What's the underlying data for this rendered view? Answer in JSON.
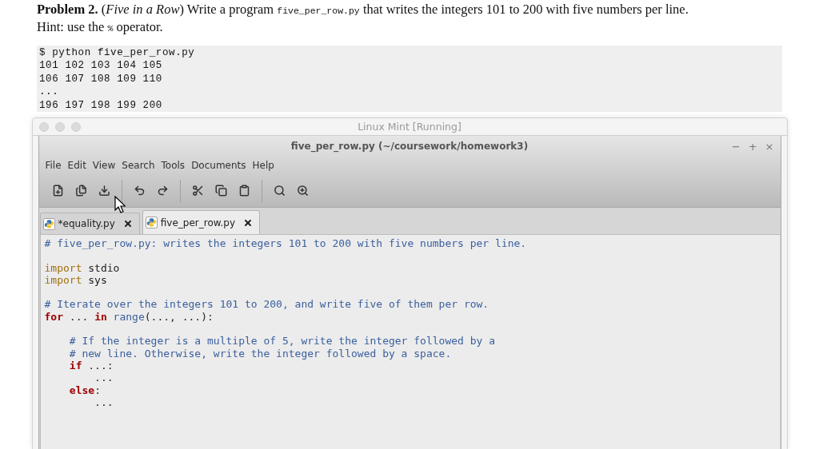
{
  "problem": {
    "parts": [
      {
        "kind": "text",
        "text": "**Problem 2.** (*Five in a Row*) Write a program "
      },
      {
        "kind": "code",
        "text": "five_per_row.py"
      },
      {
        "kind": "text",
        "text": " that writes the integers 101 to 200 with five numbers per line."
      }
    ],
    "hint": [
      {
        "kind": "text",
        "text": "Hint: use the "
      },
      {
        "kind": "code",
        "text": "%"
      },
      {
        "kind": "text",
        "text": " operator."
      }
    ]
  },
  "terminal": {
    "lines": [
      "$ python five_per_row.py",
      "101 102 103 104 105",
      "106 107 108 109 110",
      "...",
      "196 197 198 199 200"
    ]
  },
  "vm_window": {
    "title": "Linux Mint [Running]"
  },
  "editor_window": {
    "title": "five_per_row.py (~/coursework/homework3)",
    "window_controls": [
      "−",
      "+",
      "×"
    ],
    "menu": [
      "File",
      "Edit",
      "View",
      "Search",
      "Tools",
      "Documents",
      "Help"
    ],
    "tabs": [
      {
        "label": "*equality.py",
        "selected": false
      },
      {
        "label": "five_per_row.py",
        "selected": true
      }
    ],
    "code_lines": [
      {
        "kind": "code",
        "tokens": [
          {
            "kind": "comment",
            "text": "# five_per_row.py: writes the integers 101 to 200 with five numbers per line."
          }
        ]
      },
      {
        "kind": "blank"
      },
      {
        "kind": "code",
        "tokens": [
          {
            "kind": "import",
            "text": "import"
          },
          {
            "kind": "plain",
            "text": " stdio"
          }
        ]
      },
      {
        "kind": "code",
        "tokens": [
          {
            "kind": "import",
            "text": "import"
          },
          {
            "kind": "plain",
            "text": " sys"
          }
        ]
      },
      {
        "kind": "blank"
      },
      {
        "kind": "code",
        "tokens": [
          {
            "kind": "comment",
            "text": "# Iterate over the integers 101 to 200, and write five of them per row."
          }
        ]
      },
      {
        "kind": "code",
        "tokens": [
          {
            "kind": "keyword",
            "text": "for"
          },
          {
            "kind": "plain",
            "text": " ... "
          },
          {
            "kind": "keyword",
            "text": "in"
          },
          {
            "kind": "builtin",
            "text": " range"
          },
          {
            "kind": "plain",
            "text": "(..., ...):"
          }
        ]
      },
      {
        "kind": "blank"
      },
      {
        "kind": "code",
        "tokens": [
          {
            "kind": "comment",
            "text": "    # If the integer is a multiple of 5, write the integer followed by a"
          }
        ]
      },
      {
        "kind": "code",
        "tokens": [
          {
            "kind": "comment",
            "text": "    # new line. Otherwise, write the integer followed by a space."
          }
        ]
      },
      {
        "kind": "code",
        "tokens": [
          {
            "kind": "keyword",
            "text": "    if"
          },
          {
            "kind": "plain",
            "text": " ...:"
          }
        ]
      },
      {
        "kind": "code",
        "tokens": [
          {
            "kind": "plain",
            "text": "        ..."
          }
        ]
      },
      {
        "kind": "code",
        "tokens": [
          {
            "kind": "keyword",
            "text": "    else"
          },
          {
            "kind": "plain",
            "text": ":"
          }
        ]
      },
      {
        "kind": "code",
        "tokens": [
          {
            "kind": "plain",
            "text": "        ..."
          }
        ]
      }
    ]
  }
}
